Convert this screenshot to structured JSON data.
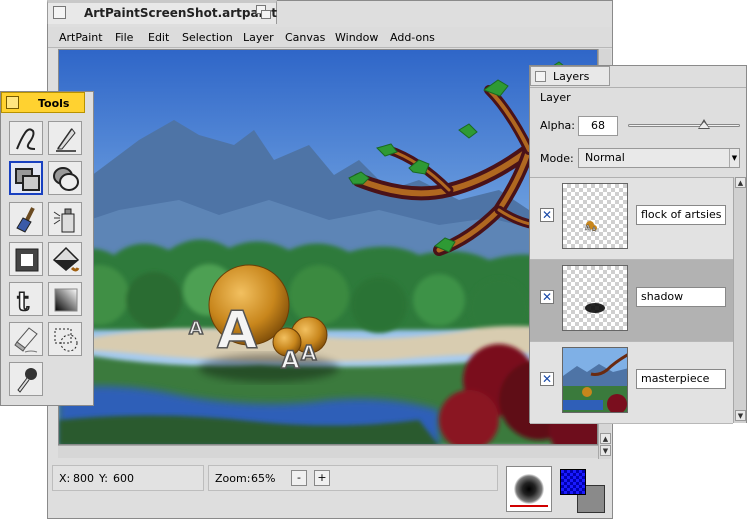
{
  "main_window": {
    "title": "ArtPaintScreenShot.artpaint",
    "menu": [
      "ArtPaint",
      "File",
      "Edit",
      "Selection",
      "Layer",
      "Canvas",
      "Window",
      "Add-ons"
    ]
  },
  "status": {
    "x_label": "X:",
    "x_value": "800",
    "y_label": "Y:",
    "y_value": "600",
    "zoom_label": "Zoom:",
    "zoom_value": "65%",
    "zoom_out": "-",
    "zoom_in": "+"
  },
  "colors": {
    "foreground": "#1a1aff",
    "background": "#8a8a8a",
    "tools_tab": "#ffd230",
    "selection_border": "#1840c0"
  },
  "tools_window": {
    "title": "Tools",
    "tools": [
      {
        "name": "freehand-line-icon",
        "active": false
      },
      {
        "name": "straight-line-icon",
        "active": false
      },
      {
        "name": "rectangle-icon",
        "active": true
      },
      {
        "name": "ellipse-icon",
        "active": false
      },
      {
        "name": "brush-icon",
        "active": false
      },
      {
        "name": "airbrush-icon",
        "active": false
      },
      {
        "name": "blur-icon",
        "active": false
      },
      {
        "name": "fill-bucket-icon",
        "active": false
      },
      {
        "name": "text-tool-icon",
        "active": false
      },
      {
        "name": "gradient-icon",
        "active": false
      },
      {
        "name": "eraser-icon",
        "active": false
      },
      {
        "name": "selection-icon",
        "active": false
      },
      {
        "name": "color-picker-icon",
        "active": false
      }
    ]
  },
  "layers_window": {
    "title": "Layers",
    "menu_label": "Layer",
    "alpha_label": "Alpha:",
    "alpha_value": "68",
    "alpha_fraction": 0.68,
    "mode_label": "Mode:",
    "mode_value": "Normal",
    "layers": [
      {
        "name": "flock of artsies",
        "visible": true,
        "selected": false
      },
      {
        "name": "shadow",
        "visible": true,
        "selected": true
      },
      {
        "name": "masterpiece",
        "visible": true,
        "selected": false
      }
    ]
  }
}
